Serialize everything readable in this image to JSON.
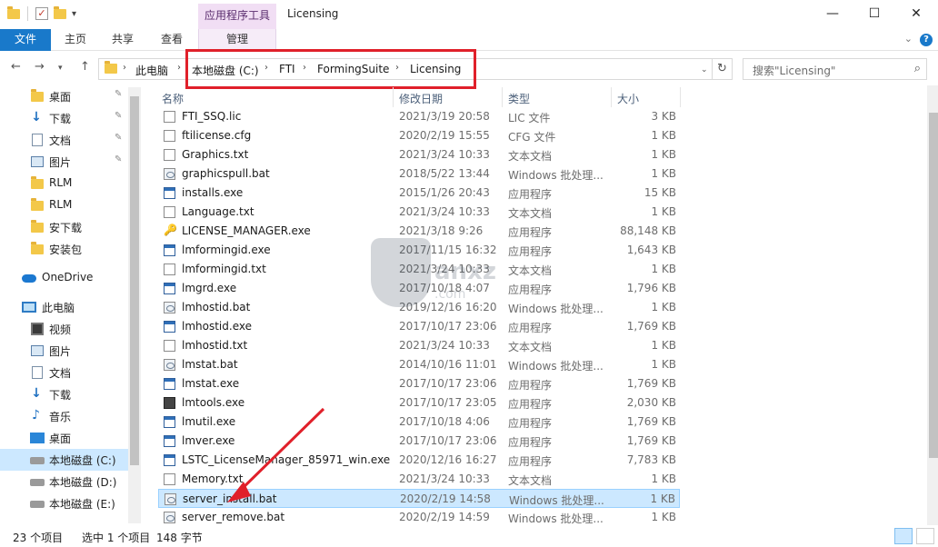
{
  "window": {
    "title": "Licensing",
    "context_tab": "应用程序工具",
    "minimize": "—",
    "maximize": "☐",
    "close": "✕"
  },
  "ribbon": {
    "tabs": [
      "文件",
      "主页",
      "共享",
      "查看",
      "管理"
    ]
  },
  "address": {
    "breadcrumbs": [
      "此电脑",
      "本地磁盘 (C:)",
      "FTI",
      "FormingSuite",
      "Licensing"
    ],
    "search_placeholder": "搜索\"Licensing\""
  },
  "sidebar": {
    "items": [
      {
        "label": "桌面",
        "icon": "folder-icon",
        "pinned": true
      },
      {
        "label": "下载",
        "icon": "download-arrow-icon",
        "pinned": true
      },
      {
        "label": "文档",
        "icon": "document-icon",
        "pinned": true
      },
      {
        "label": "图片",
        "icon": "picture-icon",
        "pinned": true
      },
      {
        "label": "RLM",
        "icon": "folder-icon",
        "pinned": false
      },
      {
        "label": "RLM",
        "icon": "folder-icon",
        "pinned": false
      },
      {
        "label": "安下载",
        "icon": "folder-icon",
        "pinned": false
      },
      {
        "label": "安装包",
        "icon": "folder-icon",
        "pinned": false
      },
      {
        "label": "OneDrive",
        "icon": "onedrive-cloud-icon",
        "pinned": false
      },
      {
        "label": "此电脑",
        "icon": "this-pc-icon",
        "pinned": false
      },
      {
        "label": "视频",
        "icon": "video-icon",
        "pinned": false
      },
      {
        "label": "图片",
        "icon": "picture-icon",
        "pinned": false
      },
      {
        "label": "文档",
        "icon": "document-icon",
        "pinned": false
      },
      {
        "label": "下载",
        "icon": "download-arrow-icon",
        "pinned": false
      },
      {
        "label": "音乐",
        "icon": "music-icon",
        "pinned": false
      },
      {
        "label": "桌面",
        "icon": "desktop-icon",
        "pinned": false
      },
      {
        "label": "本地磁盘 (C:)",
        "icon": "drive-icon",
        "pinned": false
      },
      {
        "label": "本地磁盘 (D:)",
        "icon": "drive-icon",
        "pinned": false
      },
      {
        "label": "本地磁盘 (E:)",
        "icon": "drive-icon",
        "pinned": false
      }
    ]
  },
  "columns": [
    "名称",
    "修改日期",
    "类型",
    "大小"
  ],
  "files": [
    {
      "name": "FTI_SSQ.lic",
      "date": "2021/3/19 20:58",
      "type": "LIC 文件",
      "size": "3 KB",
      "icon": "txt"
    },
    {
      "name": "ftilicense.cfg",
      "date": "2020/2/19 15:55",
      "type": "CFG 文件",
      "size": "1 KB",
      "icon": "cfg"
    },
    {
      "name": "Graphics.txt",
      "date": "2021/3/24 10:33",
      "type": "文本文档",
      "size": "1 KB",
      "icon": "txt"
    },
    {
      "name": "graphicspull.bat",
      "date": "2018/5/22 13:44",
      "type": "Windows 批处理...",
      "size": "1 KB",
      "icon": "bat"
    },
    {
      "name": "installs.exe",
      "date": "2015/1/26 20:43",
      "type": "应用程序",
      "size": "15 KB",
      "icon": "exe"
    },
    {
      "name": "Language.txt",
      "date": "2021/3/24 10:33",
      "type": "文本文档",
      "size": "1 KB",
      "icon": "txt"
    },
    {
      "name": "LICENSE_MANAGER.exe",
      "date": "2021/3/18 9:26",
      "type": "应用程序",
      "size": "88,148 KB",
      "icon": "key"
    },
    {
      "name": "lmformingid.exe",
      "date": "2017/11/15 16:32",
      "type": "应用程序",
      "size": "1,643 KB",
      "icon": "exe"
    },
    {
      "name": "lmformingid.txt",
      "date": "2021/3/24 10:33",
      "type": "文本文档",
      "size": "1 KB",
      "icon": "txt"
    },
    {
      "name": "lmgrd.exe",
      "date": "2017/10/18 4:07",
      "type": "应用程序",
      "size": "1,796 KB",
      "icon": "exe"
    },
    {
      "name": "lmhostid.bat",
      "date": "2019/12/16 16:20",
      "type": "Windows 批处理...",
      "size": "1 KB",
      "icon": "bat"
    },
    {
      "name": "lmhostid.exe",
      "date": "2017/10/17 23:06",
      "type": "应用程序",
      "size": "1,769 KB",
      "icon": "exe"
    },
    {
      "name": "lmhostid.txt",
      "date": "2021/3/24 10:33",
      "type": "文本文档",
      "size": "1 KB",
      "icon": "txt"
    },
    {
      "name": "lmstat.bat",
      "date": "2014/10/16 11:01",
      "type": "Windows 批处理...",
      "size": "1 KB",
      "icon": "bat"
    },
    {
      "name": "lmstat.exe",
      "date": "2017/10/17 23:06",
      "type": "应用程序",
      "size": "1,769 KB",
      "icon": "exe"
    },
    {
      "name": "lmtools.exe",
      "date": "2017/10/17 23:05",
      "type": "应用程序",
      "size": "2,030 KB",
      "icon": "tools"
    },
    {
      "name": "lmutil.exe",
      "date": "2017/10/18 4:06",
      "type": "应用程序",
      "size": "1,769 KB",
      "icon": "exe"
    },
    {
      "name": "lmver.exe",
      "date": "2017/10/17 23:06",
      "type": "应用程序",
      "size": "1,769 KB",
      "icon": "exe"
    },
    {
      "name": "LSTC_LicenseManager_85971_win.exe",
      "date": "2020/12/16 16:27",
      "type": "应用程序",
      "size": "7,783 KB",
      "icon": "exe"
    },
    {
      "name": "Memory.txt",
      "date": "2021/3/24 10:33",
      "type": "文本文档",
      "size": "1 KB",
      "icon": "txt"
    },
    {
      "name": "server_install.bat",
      "date": "2020/2/19 14:58",
      "type": "Windows 批处理...",
      "size": "1 KB",
      "icon": "bat",
      "selected": true
    },
    {
      "name": "server_remove.bat",
      "date": "2020/2/19 14:59",
      "type": "Windows 批处理...",
      "size": "1 KB",
      "icon": "bat"
    }
  ],
  "status": {
    "count": "23 个项目",
    "selection": "选中 1 个项目",
    "size": "148 字节"
  },
  "watermark": {
    "text": "anxz",
    "sub": ".com"
  },
  "colors": {
    "accent": "#1979ca",
    "selection": "#cce8ff",
    "annotation": "#e0202a"
  }
}
